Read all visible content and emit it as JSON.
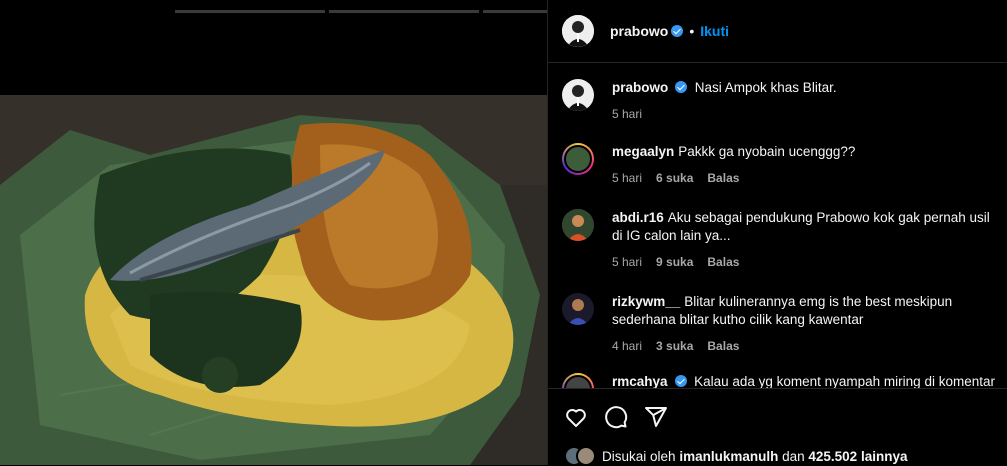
{
  "post": {
    "author": "prabowo",
    "follow_label": "Ikuti",
    "separator": "•",
    "caption": "Nasi Ampok khas Blitar.",
    "caption_time": "5 hari"
  },
  "comments": [
    {
      "user": "megaalyn",
      "text": "Pakkk ga nyobain ucenggg??",
      "time": "5 hari",
      "likes": "6 suka",
      "reply": "Balas"
    },
    {
      "user": "abdi.r16",
      "text": "Aku sebagai pendukung Prabowo kok gak pernah usil di IG calon lain ya...",
      "time": "5 hari",
      "likes": "9 suka",
      "reply": "Balas"
    },
    {
      "user": "rizkywm__",
      "text": "Blitar kulinerannya emg is the best meskipun sederhana blitar kutho cilik kang kawentar",
      "time": "4 hari",
      "likes": "3 suka",
      "reply": "Balas"
    },
    {
      "user": "rmcahya",
      "text": "Kalau ada yg koment nyampah miring di komentar",
      "time": "",
      "likes": "",
      "reply": ""
    }
  ],
  "likes_line": {
    "prefix": "Disukai oleh",
    "user": "imanlukmanulh",
    "middle": "dan",
    "count": "425.502 lainnya"
  },
  "icons": [
    "heart-icon",
    "comment-icon",
    "share-icon",
    "verified-badge-icon"
  ],
  "colors": {
    "accent": "#0095f6",
    "verified": "#3897f0",
    "muted": "#a8a8a8",
    "background": "#000000"
  }
}
